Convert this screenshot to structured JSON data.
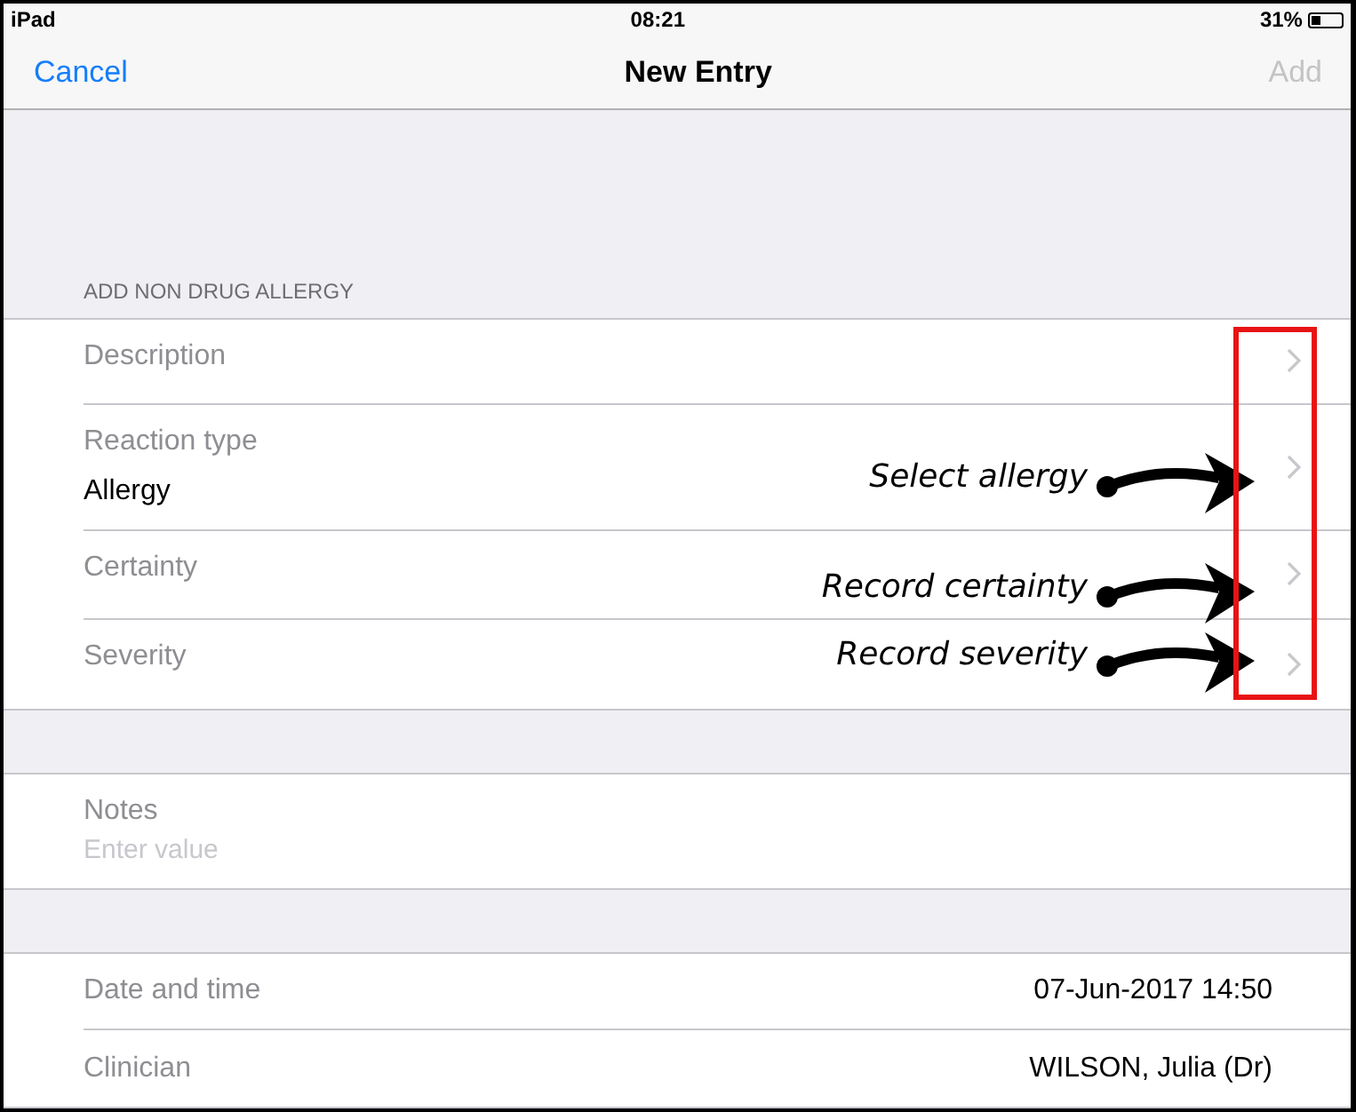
{
  "status_bar": {
    "device": "iPad",
    "time": "08:21",
    "battery": "31%"
  },
  "nav_bar": {
    "cancel": "Cancel",
    "title": "New Entry",
    "add": {
      "label": "Add",
      "disabled": true
    }
  },
  "section_header": "ADD NON DRUG ALLERGY",
  "highlight_chevrons": true,
  "allergy_rows": [
    {
      "kind": "picker",
      "label": "Description"
    },
    {
      "kind": "picker",
      "label": "Reaction type",
      "value": "Allergy",
      "annotation": "Select allergy"
    },
    {
      "kind": "picker",
      "label": "Certainty",
      "annotation": "Record certainty"
    },
    {
      "kind": "picker",
      "label": "Severity",
      "annotation": "Record severity"
    }
  ],
  "notes": {
    "label": "Notes",
    "placeholder": "Enter value"
  },
  "detail_rows": [
    {
      "label": "Date and time",
      "value": "07-Jun-2017 14:50"
    },
    {
      "label": "Clinician",
      "value": "WILSON, Julia (Dr)"
    }
  ]
}
